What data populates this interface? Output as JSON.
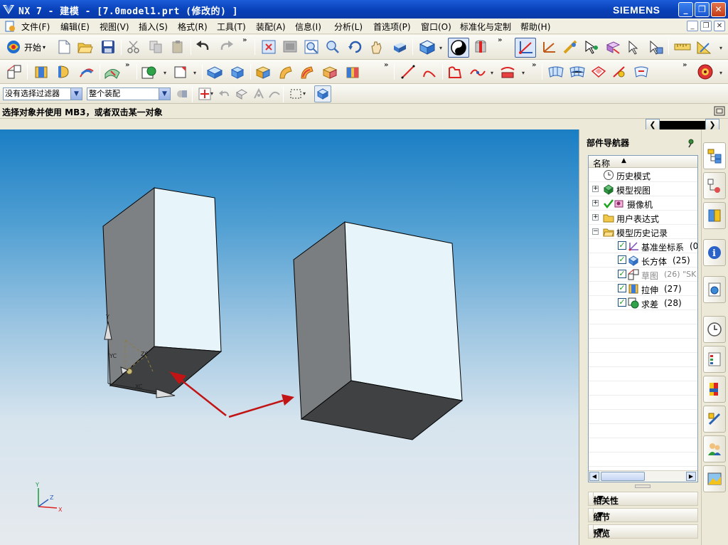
{
  "window": {
    "title": "NX 7 - 建模 - [7.0model1.prt  (修改的) ]",
    "brand": "SIEMENS",
    "buttons": {
      "minimize": "_",
      "restore": "❐",
      "close": "✕"
    }
  },
  "menu": {
    "items": [
      "文件(F)",
      "编辑(E)",
      "视图(V)",
      "插入(S)",
      "格式(R)",
      "工具(T)",
      "装配(A)",
      "信息(I)",
      "分析(L)",
      "首选项(P)",
      "窗口(O)",
      "标准化与定制",
      "帮助(H)"
    ]
  },
  "toolbar": {
    "start_label": "开始"
  },
  "filter": {
    "type_filter": "没有选择过滤器",
    "scope": "整个装配"
  },
  "status": {
    "prompt": "选择对象并使用 MB3，或者双击某一对象"
  },
  "viewport": {
    "wcs_labels": {
      "y": "Y",
      "yc": "YC",
      "xc": "XC",
      "zc": "ZC"
    },
    "triad_labels": {
      "y": "Y",
      "z": "Z",
      "x": "X"
    },
    "arrow_color": "#c21414"
  },
  "navigator": {
    "title": "部件导航器",
    "column_header": "名称",
    "tree": [
      {
        "label": "历史模式",
        "level": 0,
        "expander": "",
        "icon": "clock-icon"
      },
      {
        "label": "模型视图",
        "level": 0,
        "expander": "+",
        "icon": "model-view-icon"
      },
      {
        "label": "摄像机",
        "level": 0,
        "expander": "+",
        "icon": "camera-icon"
      },
      {
        "label": "用户表达式",
        "level": 0,
        "expander": "+",
        "icon": "folder-icon"
      },
      {
        "label": "模型历史记录",
        "level": 0,
        "expander": "−",
        "icon": "folder-icon"
      },
      {
        "label": "基准坐标系",
        "suffix": "(0",
        "level": 1,
        "icon": "datum-csys-icon"
      },
      {
        "label": "长方体",
        "suffix": "(25)",
        "level": 1,
        "icon": "block-icon"
      },
      {
        "label": "草图",
        "suffix": "(26) \"SK",
        "level": 1,
        "icon": "sketch-icon",
        "dimmed": true
      },
      {
        "label": "拉伸",
        "suffix": "(27)",
        "level": 1,
        "icon": "extrude-icon"
      },
      {
        "label": "求差",
        "suffix": "(28)",
        "level": 1,
        "icon": "subtract-icon"
      }
    ],
    "panels": [
      "相关性",
      "细节",
      "预览"
    ]
  }
}
